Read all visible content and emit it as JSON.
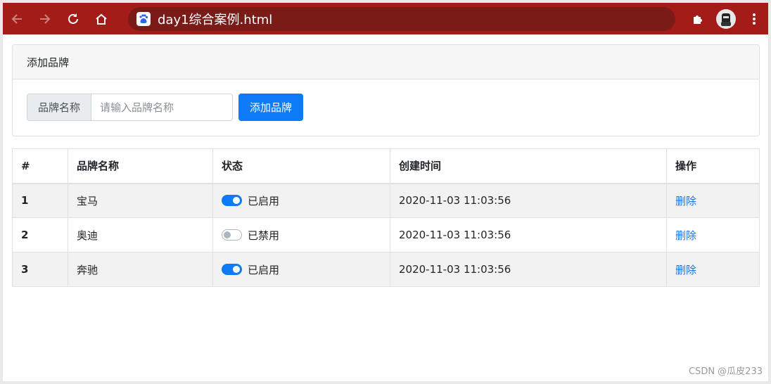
{
  "browser": {
    "url": "day1综合案例.html",
    "accent_color": "#a31c18",
    "icons": {
      "back": "arrow-left-icon",
      "forward": "arrow-right-icon",
      "reload": "reload-icon",
      "home": "home-icon",
      "site": "baidu-paw-icon",
      "extensions": "puzzle-icon",
      "profile": "avatar-icon",
      "menu": "kebab-menu-icon"
    }
  },
  "card": {
    "header": "添加品牌",
    "input_addon": "品牌名称",
    "input_placeholder": "请输入品牌名称",
    "input_value": "",
    "button_label": "添加品牌",
    "button_color": "#0d7bf7"
  },
  "table": {
    "headers": [
      "#",
      "品牌名称",
      "状态",
      "创建时间",
      "操作"
    ],
    "rows": [
      {
        "id": "1",
        "name": "宝马",
        "enabled": true,
        "status": "已启用",
        "created": "2020-11-03 11:03:56",
        "action": "删除"
      },
      {
        "id": "2",
        "name": "奥迪",
        "enabled": false,
        "status": "已禁用",
        "created": "2020-11-03 11:03:56",
        "action": "删除"
      },
      {
        "id": "3",
        "name": "奔驰",
        "enabled": true,
        "status": "已启用",
        "created": "2020-11-03 11:03:56",
        "action": "删除"
      }
    ]
  },
  "watermark": "CSDN @瓜皮233"
}
